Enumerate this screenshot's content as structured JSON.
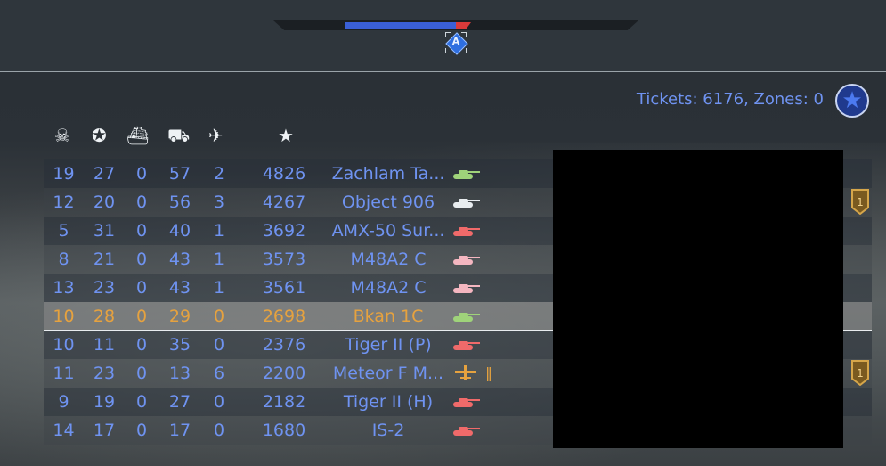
{
  "hud": {
    "zone_letter": "A",
    "colors": {
      "ally": "#3a5fd6",
      "enemy": "#d93a3a",
      "text_blue": "#6f93f1",
      "self": "#e6a23f"
    }
  },
  "tickets_label": "Tickets: 6176, Zones: 0",
  "team_emblem": "star-emblem",
  "columns": [
    {
      "icon": "skull-icon",
      "glyph": "☠"
    },
    {
      "icon": "laurel-star-icon",
      "glyph": "✪"
    },
    {
      "icon": "ship-icon",
      "glyph": "⛴"
    },
    {
      "icon": "tank-kill-icon",
      "glyph": "⛟"
    },
    {
      "icon": "aircraft-kill-icon",
      "glyph": "✈"
    },
    {
      "icon": "score-star-icon",
      "glyph": "★"
    }
  ],
  "players": [
    {
      "c0": "19",
      "c1": "27",
      "c2": "0",
      "c3": "57",
      "c4": "2",
      "score": "4826",
      "vehicle": "Zachlam Ta...",
      "vehicle_color": "#9fd37a",
      "rank": ""
    },
    {
      "c0": "12",
      "c1": "20",
      "c2": "0",
      "c3": "56",
      "c4": "3",
      "score": "4267",
      "vehicle": "Object 906",
      "vehicle_color": "#e8ecef",
      "rank": "1"
    },
    {
      "c0": "5",
      "c1": "31",
      "c2": "0",
      "c3": "40",
      "c4": "1",
      "score": "3692",
      "vehicle": "AMX-50 Sur...",
      "vehicle_color": "#f06a6a",
      "rank": ""
    },
    {
      "c0": "8",
      "c1": "21",
      "c2": "0",
      "c3": "43",
      "c4": "1",
      "score": "3573",
      "vehicle": "M48A2 C",
      "vehicle_color": "#f4b6c0",
      "rank": ""
    },
    {
      "c0": "13",
      "c1": "23",
      "c2": "0",
      "c3": "43",
      "c4": "1",
      "score": "3561",
      "vehicle": "M48A2 C",
      "vehicle_color": "#f4b6c0",
      "rank": ""
    },
    {
      "c0": "10",
      "c1": "28",
      "c2": "0",
      "c3": "29",
      "c4": "0",
      "score": "2698",
      "vehicle": "Bkan 1C",
      "vehicle_color": "#9fd37a",
      "rank": "",
      "self": true
    },
    {
      "c0": "10",
      "c1": "11",
      "c2": "0",
      "c3": "35",
      "c4": "0",
      "score": "2376",
      "vehicle": "Tiger II (P)",
      "vehicle_color": "#f06a6a",
      "rank": ""
    },
    {
      "c0": "11",
      "c1": "23",
      "c2": "0",
      "c3": "13",
      "c4": "6",
      "score": "2200",
      "vehicle": "Meteor F M...",
      "vehicle_color": "#e6a23f",
      "rank": "1",
      "aircraft": true
    },
    {
      "c0": "9",
      "c1": "19",
      "c2": "0",
      "c3": "27",
      "c4": "0",
      "score": "2182",
      "vehicle": "Tiger II (H)",
      "vehicle_color": "#f06a6a",
      "rank": ""
    },
    {
      "c0": "14",
      "c1": "17",
      "c2": "0",
      "c3": "17",
      "c4": "0",
      "score": "1680",
      "vehicle": "IS-2",
      "vehicle_color": "#f06a6a",
      "rank": ""
    }
  ]
}
